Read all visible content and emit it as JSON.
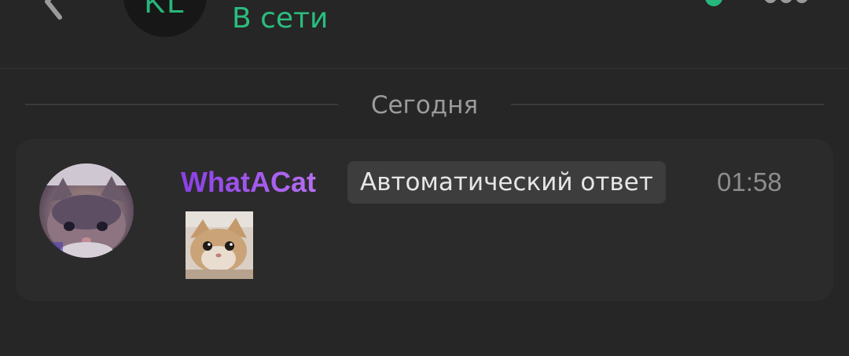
{
  "header": {
    "back_icon": "chevron-left-icon",
    "avatar_initials": "KL",
    "status": "В сети",
    "online_indicator_color": "#27b77c",
    "more_icon": "more-dots-icon"
  },
  "feed": {
    "date_separator": "Сегодня",
    "messages": [
      {
        "author": "WhatACat",
        "badge": "Автоматический ответ",
        "time": "01:58",
        "avatar_icon": "cat-avatar",
        "attachment_icon": "cat-photo-thumbnail"
      }
    ]
  },
  "colors": {
    "background": "#262626",
    "card": "#2b2b2b",
    "status_green": "#2bbd7e",
    "author_purple": "#a458ee",
    "badge_bg": "#3d3d3d"
  }
}
